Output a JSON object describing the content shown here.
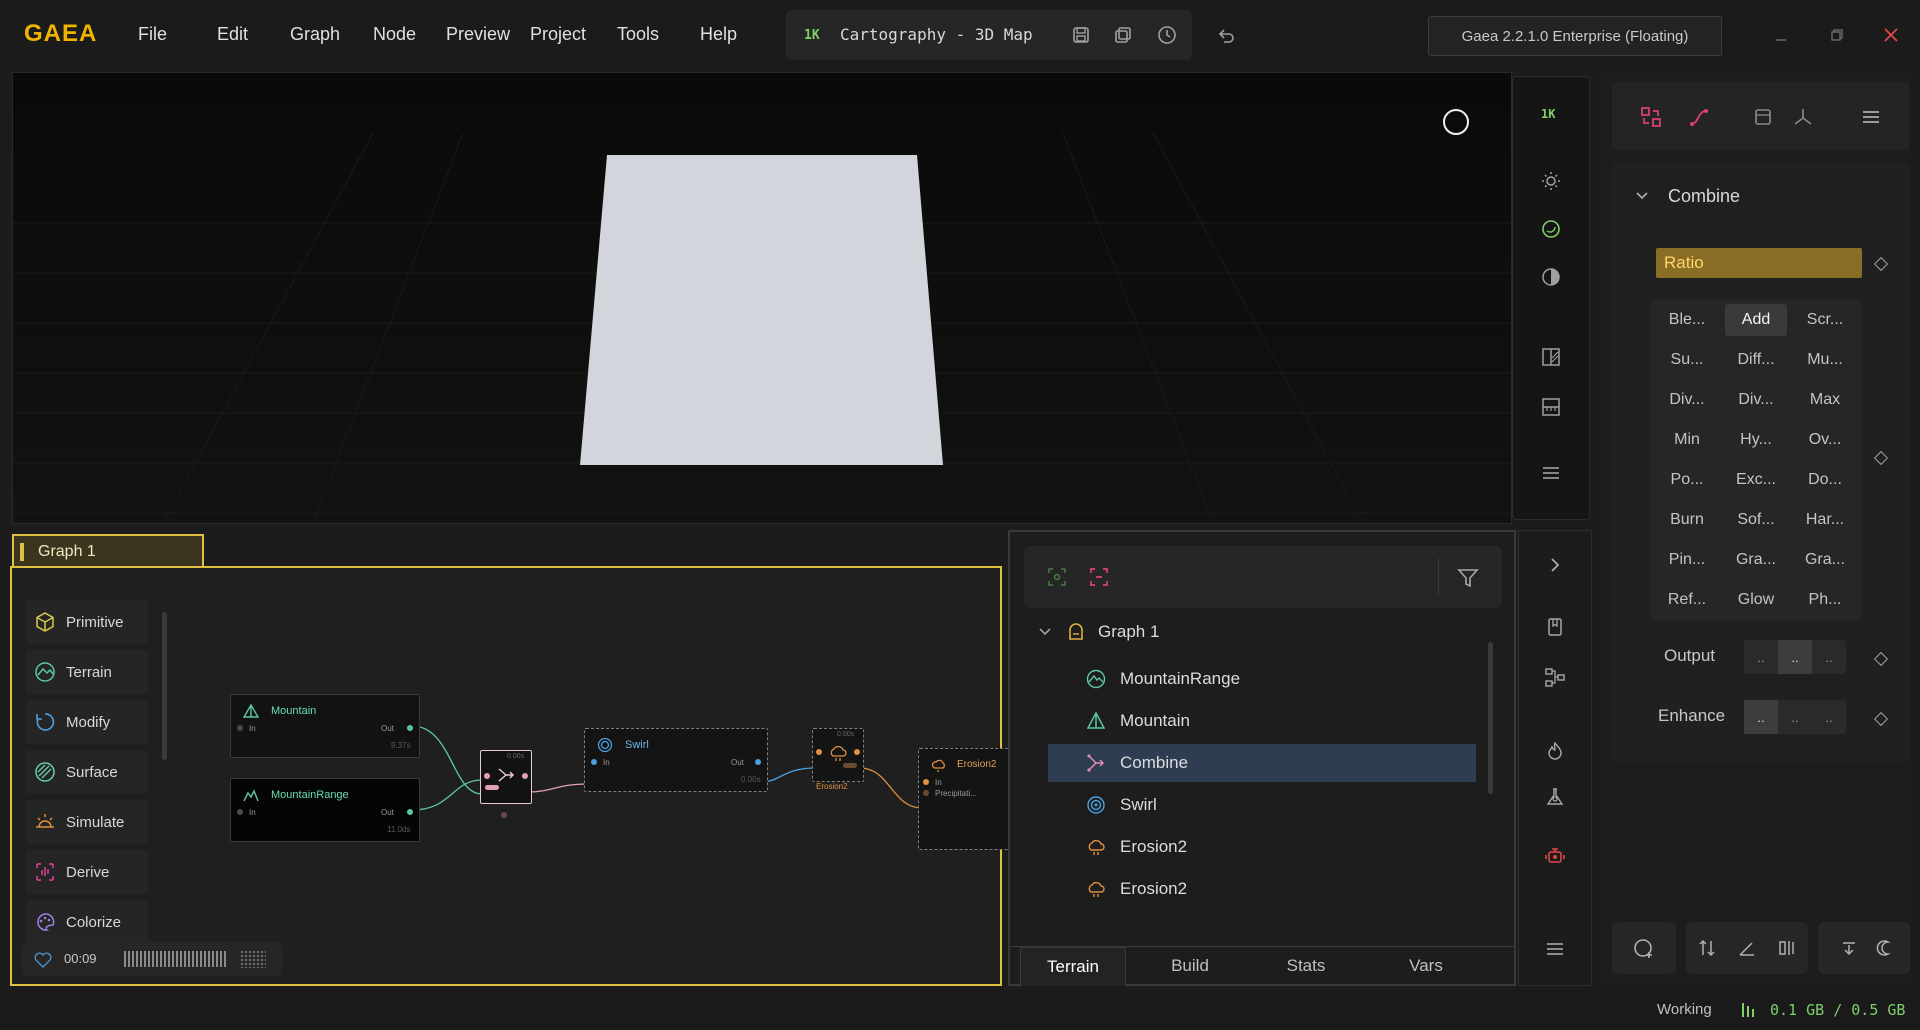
{
  "app": {
    "logo": "GAEA"
  },
  "menu": [
    "File",
    "Edit",
    "Graph",
    "Node",
    "Preview",
    "Project",
    "Tools",
    "Help"
  ],
  "project": {
    "resolution": "1K",
    "title": "Cartography - 3D Map"
  },
  "version": "Gaea 2.2.1.0 Enterprise (Floating)",
  "viewport": {
    "resolution": "1K"
  },
  "properties": {
    "node_name": "Combine",
    "ratio_label": "Ratio",
    "blend_modes": [
      "Ble...",
      "Add",
      "Scr...",
      "Su...",
      "Diff...",
      "Mu...",
      "Div...",
      "Div...",
      "Max",
      "Min",
      "Hy...",
      "Ov...",
      "Po...",
      "Exc...",
      "Do...",
      "Burn",
      "Sof...",
      "Har...",
      "Pin...",
      "Gra...",
      "Gra...",
      "Ref...",
      "Glow",
      "Ph..."
    ],
    "selected_blend": "Add",
    "output_label": "Output",
    "output_options": [
      "..",
      "..",
      ".."
    ],
    "enhance_label": "Enhance",
    "enhance_options": [
      "..",
      "..",
      ".."
    ]
  },
  "graph": {
    "tab": "Graph 1",
    "categories": [
      "Primitive",
      "Terrain",
      "Modify",
      "Surface",
      "Simulate",
      "Derive",
      "Colorize"
    ],
    "timer": "00:09",
    "nodes": {
      "mountain": {
        "title": "Mountain",
        "in": "In",
        "out": "Out",
        "time": "9.37s"
      },
      "mountainrange": {
        "title": "MountainRange",
        "in": "In",
        "out": "Out",
        "time": "11.0ds"
      },
      "combine": {
        "time": "0.00s"
      },
      "swirl": {
        "title": "Swirl",
        "in": "In",
        "out": "Out",
        "time": "0.00s"
      },
      "erosion2a": {
        "title": "Erosion2",
        "time": "0.00s"
      },
      "erosion2b": {
        "title": "Erosion2",
        "in": "In",
        "precip": "Precipitati..."
      }
    }
  },
  "tree": {
    "root": "Graph 1",
    "items": [
      "MountainRange",
      "Mountain",
      "Combine",
      "Swirl",
      "Erosion2",
      "Erosion2"
    ],
    "selected": "Combine",
    "tabs": [
      "Terrain",
      "Build",
      "Stats",
      "Vars"
    ],
    "active_tab": "Terrain"
  },
  "status": {
    "state": "Working",
    "memory": "0.1 GB / 0.5 GB"
  },
  "colors": {
    "accent": "#f0b400",
    "selection": "#2e3d52",
    "graph_border": "#e0c040"
  }
}
